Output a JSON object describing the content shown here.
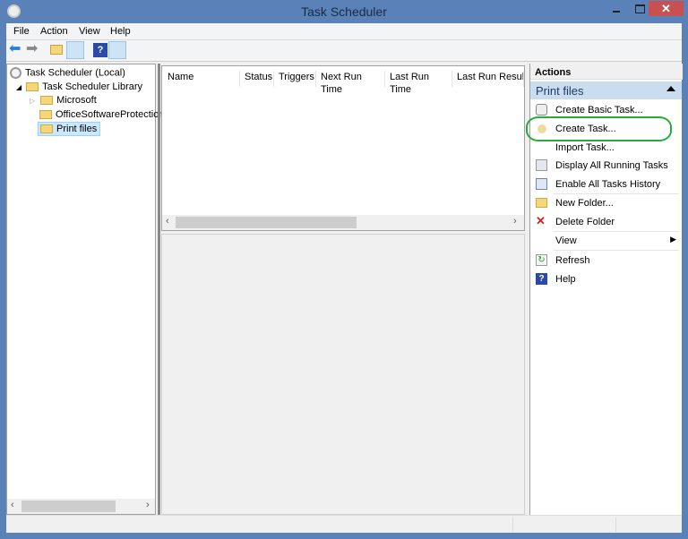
{
  "window": {
    "title": "Task Scheduler",
    "close": "✕"
  },
  "menu": [
    "File",
    "Action",
    "View",
    "Help"
  ],
  "tree": {
    "root": "Task Scheduler (Local)",
    "library": "Task Scheduler Library",
    "children": [
      "Microsoft",
      "OfficeSoftwareProtection",
      "Print files"
    ],
    "selected": "Print files"
  },
  "columns": [
    "Name",
    "Status",
    "Triggers",
    "Next Run Time",
    "Last Run Time",
    "Last Run Result"
  ],
  "actions": {
    "header": "Actions",
    "section": "Print files",
    "items": [
      "Create Basic Task...",
      "Create Task...",
      "Import Task...",
      "Display All Running Tasks",
      "Enable All Tasks History",
      "New Folder...",
      "Delete Folder",
      "View",
      "Refresh",
      "Help"
    ]
  },
  "colors": {
    "titlebar": "#5a82b8",
    "close": "#c75050",
    "highlight": "#2aab3a",
    "section": "#c9dcf0"
  }
}
